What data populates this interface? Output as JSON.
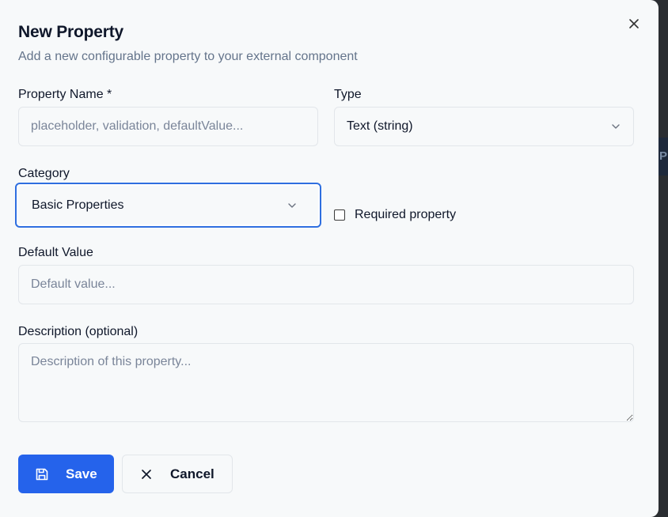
{
  "dialog": {
    "title": "New Property",
    "subtitle": "Add a new configurable property to your external component",
    "close_icon": "close-icon"
  },
  "fields": {
    "property_name": {
      "label": "Property Name *",
      "value": "",
      "placeholder": "placeholder, validation, defaultValue..."
    },
    "type": {
      "label": "Type",
      "selected": "Text (string)",
      "icon": "chevron-down-icon"
    },
    "category": {
      "label": "Category",
      "selected": "Basic Properties",
      "icon": "chevron-down-icon",
      "focused": true
    },
    "required": {
      "label": "Required property",
      "checked": false
    },
    "default_value": {
      "label": "Default Value",
      "value": "",
      "placeholder": "Default value..."
    },
    "description": {
      "label": "Description (optional)",
      "value": "",
      "placeholder": "Description of this property..."
    }
  },
  "actions": {
    "save_label": "Save",
    "save_icon": "save-icon",
    "cancel_label": "Cancel",
    "cancel_icon": "close-icon"
  },
  "background": {
    "peek_text": "P"
  },
  "colors": {
    "primary": "#2563eb",
    "focus_ring": "#2f6fe0",
    "muted_text": "#64748b",
    "border": "#e2e6ea"
  }
}
